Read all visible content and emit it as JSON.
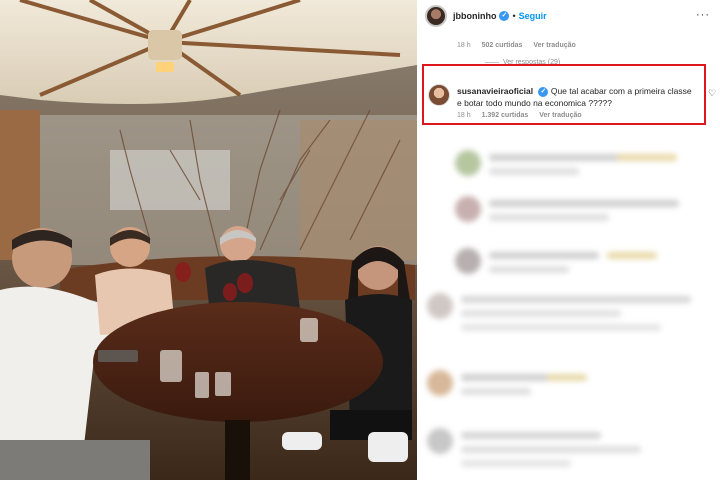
{
  "post": {
    "username": "jbboninho",
    "follow_label": "Seguir",
    "separator": "•",
    "more": "···"
  },
  "first_comment": {
    "time": "18 h",
    "likes": "502 curtidas",
    "translate": "Ver tradução"
  },
  "replies_label": "Ver respostas (29)",
  "highlighted_comment": {
    "username": "susanavieiraoficial",
    "text": "Que tal acabar com a primeira classe e botar todo mundo na economica ?????",
    "time": "18 h",
    "likes": "1.392 curtidas",
    "translate": "Ver tradução",
    "outline_color": "#e0161f"
  },
  "colors": {
    "verified": "#3897f0",
    "follow": "#0095f6"
  },
  "icons": {
    "verified": "verified-badge-icon",
    "like": "heart-icon",
    "more": "more-options-icon"
  }
}
